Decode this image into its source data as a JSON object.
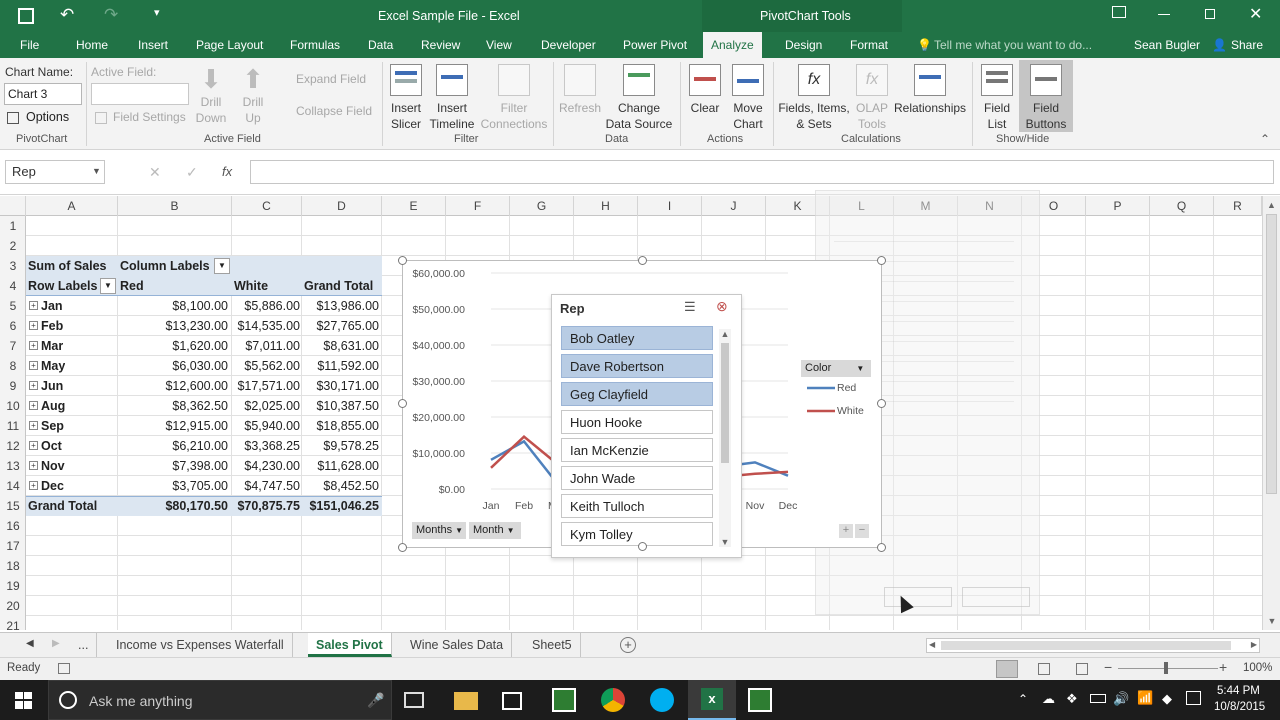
{
  "window": {
    "title": "Excel Sample File - Excel",
    "context": "PivotChart Tools"
  },
  "ribbon_tabs": [
    "File",
    "Home",
    "Insert",
    "Page Layout",
    "Formulas",
    "Data",
    "Review",
    "View",
    "Developer",
    "Power Pivot",
    "Analyze",
    "Design",
    "Format"
  ],
  "tell_me": "Tell me what you want to do...",
  "user": "Sean Bugler",
  "share": "Share",
  "ribbon": {
    "chart_name_label": "Chart Name:",
    "chart_name_value": "Chart 3",
    "options": "Options",
    "pivotchart_group": "PivotChart",
    "active_field_label": "Active Field:",
    "field_settings": "Field Settings",
    "drill_down": "Drill Down",
    "drill_up": "Drill Up",
    "expand_field": "Expand Field",
    "collapse_field": "Collapse Field",
    "active_field_group": "Active Field",
    "insert_slicer": "Insert Slicer",
    "insert_timeline": "Insert Timeline",
    "filter_connections": "Filter Connections",
    "filter_group": "Filter",
    "refresh": "Refresh",
    "change_data_source": "Change Data Source",
    "data_group": "Data",
    "clear": "Clear",
    "move_chart": "Move Chart",
    "actions_group": "Actions",
    "fields_items_sets": "Fields, Items, & Sets",
    "olap_tools": "OLAP Tools",
    "relationships": "Relationships",
    "calculations_group": "Calculations",
    "field_list": "Field List",
    "field_buttons": "Field Buttons",
    "showhide_group": "Show/Hide"
  },
  "formula": {
    "name_box": "Rep",
    "fx": "fx"
  },
  "columns": [
    "A",
    "B",
    "C",
    "D",
    "E",
    "F",
    "G",
    "H",
    "I",
    "J",
    "K",
    "L",
    "M",
    "N",
    "O",
    "P",
    "Q",
    "R"
  ],
  "rows": [
    "1",
    "2",
    "3",
    "4",
    "5",
    "6",
    "7",
    "8",
    "9",
    "10",
    "11",
    "12",
    "13",
    "14",
    "15",
    "16",
    "17",
    "18",
    "19",
    "20",
    "21"
  ],
  "pivot": {
    "sum_label": "Sum of Sales",
    "col_labels": "Column Labels",
    "row_labels": "Row Labels",
    "headers": [
      "Red",
      "White",
      "Grand Total"
    ],
    "data": [
      [
        "Jan",
        "$8,100.00",
        "$5,886.00",
        "$13,986.00"
      ],
      [
        "Feb",
        "$13,230.00",
        "$14,535.00",
        "$27,765.00"
      ],
      [
        "Mar",
        "$1,620.00",
        "$7,011.00",
        "$8,631.00"
      ],
      [
        "May",
        "$6,030.00",
        "$5,562.00",
        "$11,592.00"
      ],
      [
        "Jun",
        "$12,600.00",
        "$17,571.00",
        "$30,171.00"
      ],
      [
        "Aug",
        "$8,362.50",
        "$2,025.00",
        "$10,387.50"
      ],
      [
        "Sep",
        "$12,915.00",
        "$5,940.00",
        "$18,855.00"
      ],
      [
        "Oct",
        "$6,210.00",
        "$3,368.25",
        "$9,578.25"
      ],
      [
        "Nov",
        "$7,398.00",
        "$4,230.00",
        "$11,628.00"
      ],
      [
        "Dec",
        "$3,705.00",
        "$4,747.50",
        "$8,452.50"
      ]
    ],
    "grand_total": [
      "Grand Total",
      "$80,170.50",
      "$70,875.75",
      "$151,046.25"
    ]
  },
  "chart_data": {
    "type": "line",
    "x": [
      "Jan",
      "Feb",
      "Mar",
      "May",
      "Jun",
      "Aug",
      "Sep",
      "Oct",
      "Nov",
      "Dec"
    ],
    "series": [
      {
        "name": "Red",
        "color": "#4f81bd",
        "values": [
          8100,
          13230,
          1620,
          6030,
          12600,
          8362.5,
          12915,
          6210,
          7398,
          3705
        ]
      },
      {
        "name": "White",
        "color": "#c0504d",
        "values": [
          5886,
          14535,
          7011,
          5562,
          17571,
          2025,
          5940,
          3368.25,
          4230,
          4747.5
        ]
      }
    ],
    "ylim": [
      0,
      60000
    ],
    "yticks": [
      "$60,000.00",
      "$50,000.00",
      "$40,000.00",
      "$30,000.00",
      "$20,000.00",
      "$10,000.00",
      "$0.00"
    ],
    "xticks": [
      "Jan",
      "Feb",
      "Mar",
      "Nov",
      "Dec"
    ],
    "legend_title": "Color",
    "legend": [
      "Red",
      "White"
    ],
    "axis_buttons": [
      "Months",
      "Month"
    ]
  },
  "slicer": {
    "title": "Rep",
    "items": [
      "Bob Oatley",
      "Dave Robertson",
      "Geg Clayfield",
      "Huon Hooke",
      "Ian McKenzie",
      "John Wade",
      "Keith Tulloch",
      "Kym Tolley"
    ],
    "selected": [
      0,
      1,
      2
    ]
  },
  "sheet_tabs": [
    "...",
    "Income vs Expenses Waterfall",
    "Sales Pivot",
    "Wine Sales Data",
    "Sheet5"
  ],
  "status": {
    "ready": "Ready",
    "zoom": "100%"
  },
  "taskbar": {
    "search": "Ask me anything",
    "time": "5:44 PM",
    "date": "10/8/2015"
  }
}
